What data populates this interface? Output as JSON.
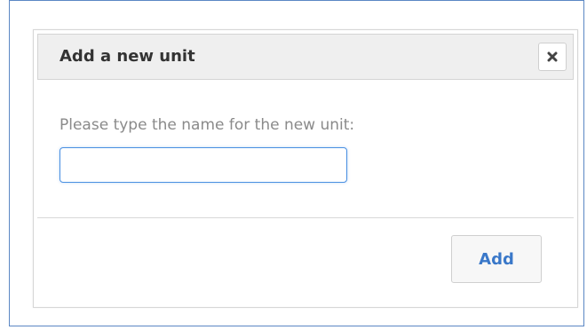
{
  "dialog": {
    "title": "Add a new unit",
    "close_icon": "close-x-icon",
    "prompt": "Please type the name for the new unit:",
    "input": {
      "value": "",
      "placeholder": ""
    },
    "add_label": "Add"
  },
  "colors": {
    "frame_border": "#5b87c4",
    "header_bg": "#efefef",
    "input_focus_border": "#4a90e2",
    "add_text": "#3a78c9",
    "prompt_text": "#8a8a8a"
  }
}
